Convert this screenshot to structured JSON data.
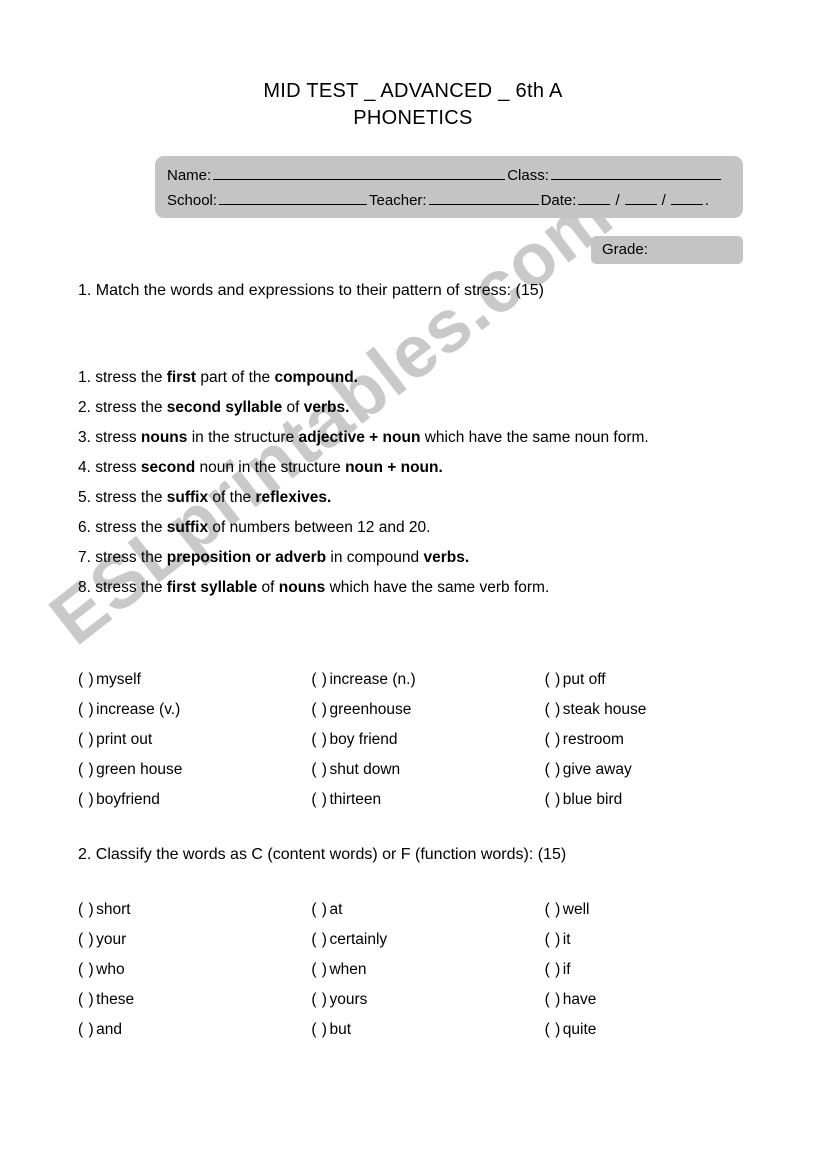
{
  "title": {
    "line1": "MID TEST _ ADVANCED _ 6th A",
    "line2": "PHONETICS"
  },
  "header": {
    "name_label": "Name:",
    "class_label": "Class:",
    "school_label": "School:",
    "teacher_label": "Teacher:",
    "date_label": "Date:",
    "date_separator": "/",
    "date_end": "."
  },
  "grade": {
    "label": "Grade:"
  },
  "question1": {
    "heading": "1. Match the words and expressions to their pattern of stress: (15)",
    "rules": [
      {
        "number": "1.",
        "parts": [
          {
            "text": " stress the ",
            "bold": false
          },
          {
            "text": "first",
            "bold": true
          },
          {
            "text": " part of the ",
            "bold": false
          },
          {
            "text": "compound.",
            "bold": true
          }
        ]
      },
      {
        "number": "2.",
        "parts": [
          {
            "text": " stress the ",
            "bold": false
          },
          {
            "text": "second syllable",
            "bold": true
          },
          {
            "text": " of ",
            "bold": false
          },
          {
            "text": "verbs.",
            "bold": true
          }
        ]
      },
      {
        "number": "3.",
        "parts": [
          {
            "text": " stress ",
            "bold": false
          },
          {
            "text": "nouns",
            "bold": true
          },
          {
            "text": " in the structure ",
            "bold": false
          },
          {
            "text": "adjective + noun",
            "bold": true
          },
          {
            "text": " which have the same noun form.",
            "bold": false
          }
        ]
      },
      {
        "number": "4.",
        "parts": [
          {
            "text": " stress ",
            "bold": false
          },
          {
            "text": "second",
            "bold": true
          },
          {
            "text": " noun in the structure ",
            "bold": false
          },
          {
            "text": "noun + noun.",
            "bold": true
          }
        ]
      },
      {
        "number": "5.",
        "parts": [
          {
            "text": " stress the ",
            "bold": false
          },
          {
            "text": "suffix",
            "bold": true
          },
          {
            "text": " of the ",
            "bold": false
          },
          {
            "text": "reflexives.",
            "bold": true
          }
        ]
      },
      {
        "number": "6.",
        "parts": [
          {
            "text": " stress the ",
            "bold": false
          },
          {
            "text": "suffix",
            "bold": true
          },
          {
            "text": " of numbers between 12 and 20.",
            "bold": false
          }
        ]
      },
      {
        "number": "7.",
        "parts": [
          {
            "text": " stress the ",
            "bold": false
          },
          {
            "text": "preposition or adverb",
            "bold": true
          },
          {
            "text": " in compound ",
            "bold": false
          },
          {
            "text": "verbs.",
            "bold": true
          }
        ]
      },
      {
        "number": "8.",
        "parts": [
          {
            "text": " stress the ",
            "bold": false
          },
          {
            "text": "first syllable",
            "bold": true
          },
          {
            "text": " of ",
            "bold": false
          },
          {
            "text": "nouns",
            "bold": true
          },
          {
            "text": " which have the same verb form.",
            "bold": false
          }
        ]
      }
    ],
    "answer_marker": "(    )",
    "rows": [
      [
        "myself",
        "increase (n.)",
        "put off"
      ],
      [
        "increase (v.)",
        "greenhouse",
        "steak house"
      ],
      [
        "print out",
        "boy friend",
        "restroom"
      ],
      [
        "green house",
        "shut down",
        "give away"
      ],
      [
        "boyfriend",
        "thirteen",
        "blue bird"
      ]
    ]
  },
  "question2": {
    "heading": "2.  Classify the words as C (content words) or F (function words): (15)",
    "answer_marker": "(    )",
    "rows": [
      [
        "short",
        "at",
        "well"
      ],
      [
        "your",
        "certainly",
        "it"
      ],
      [
        "who",
        "when",
        "if"
      ],
      [
        "these",
        "yours",
        "have"
      ],
      [
        "and",
        "but",
        "quite"
      ]
    ]
  },
  "watermark": {
    "text": "ESLprintables.com",
    "color": "#c9c9c9"
  },
  "colors": {
    "box_gray": "#c4c4c4",
    "page_background": "#ffffff",
    "text": "#000000"
  }
}
